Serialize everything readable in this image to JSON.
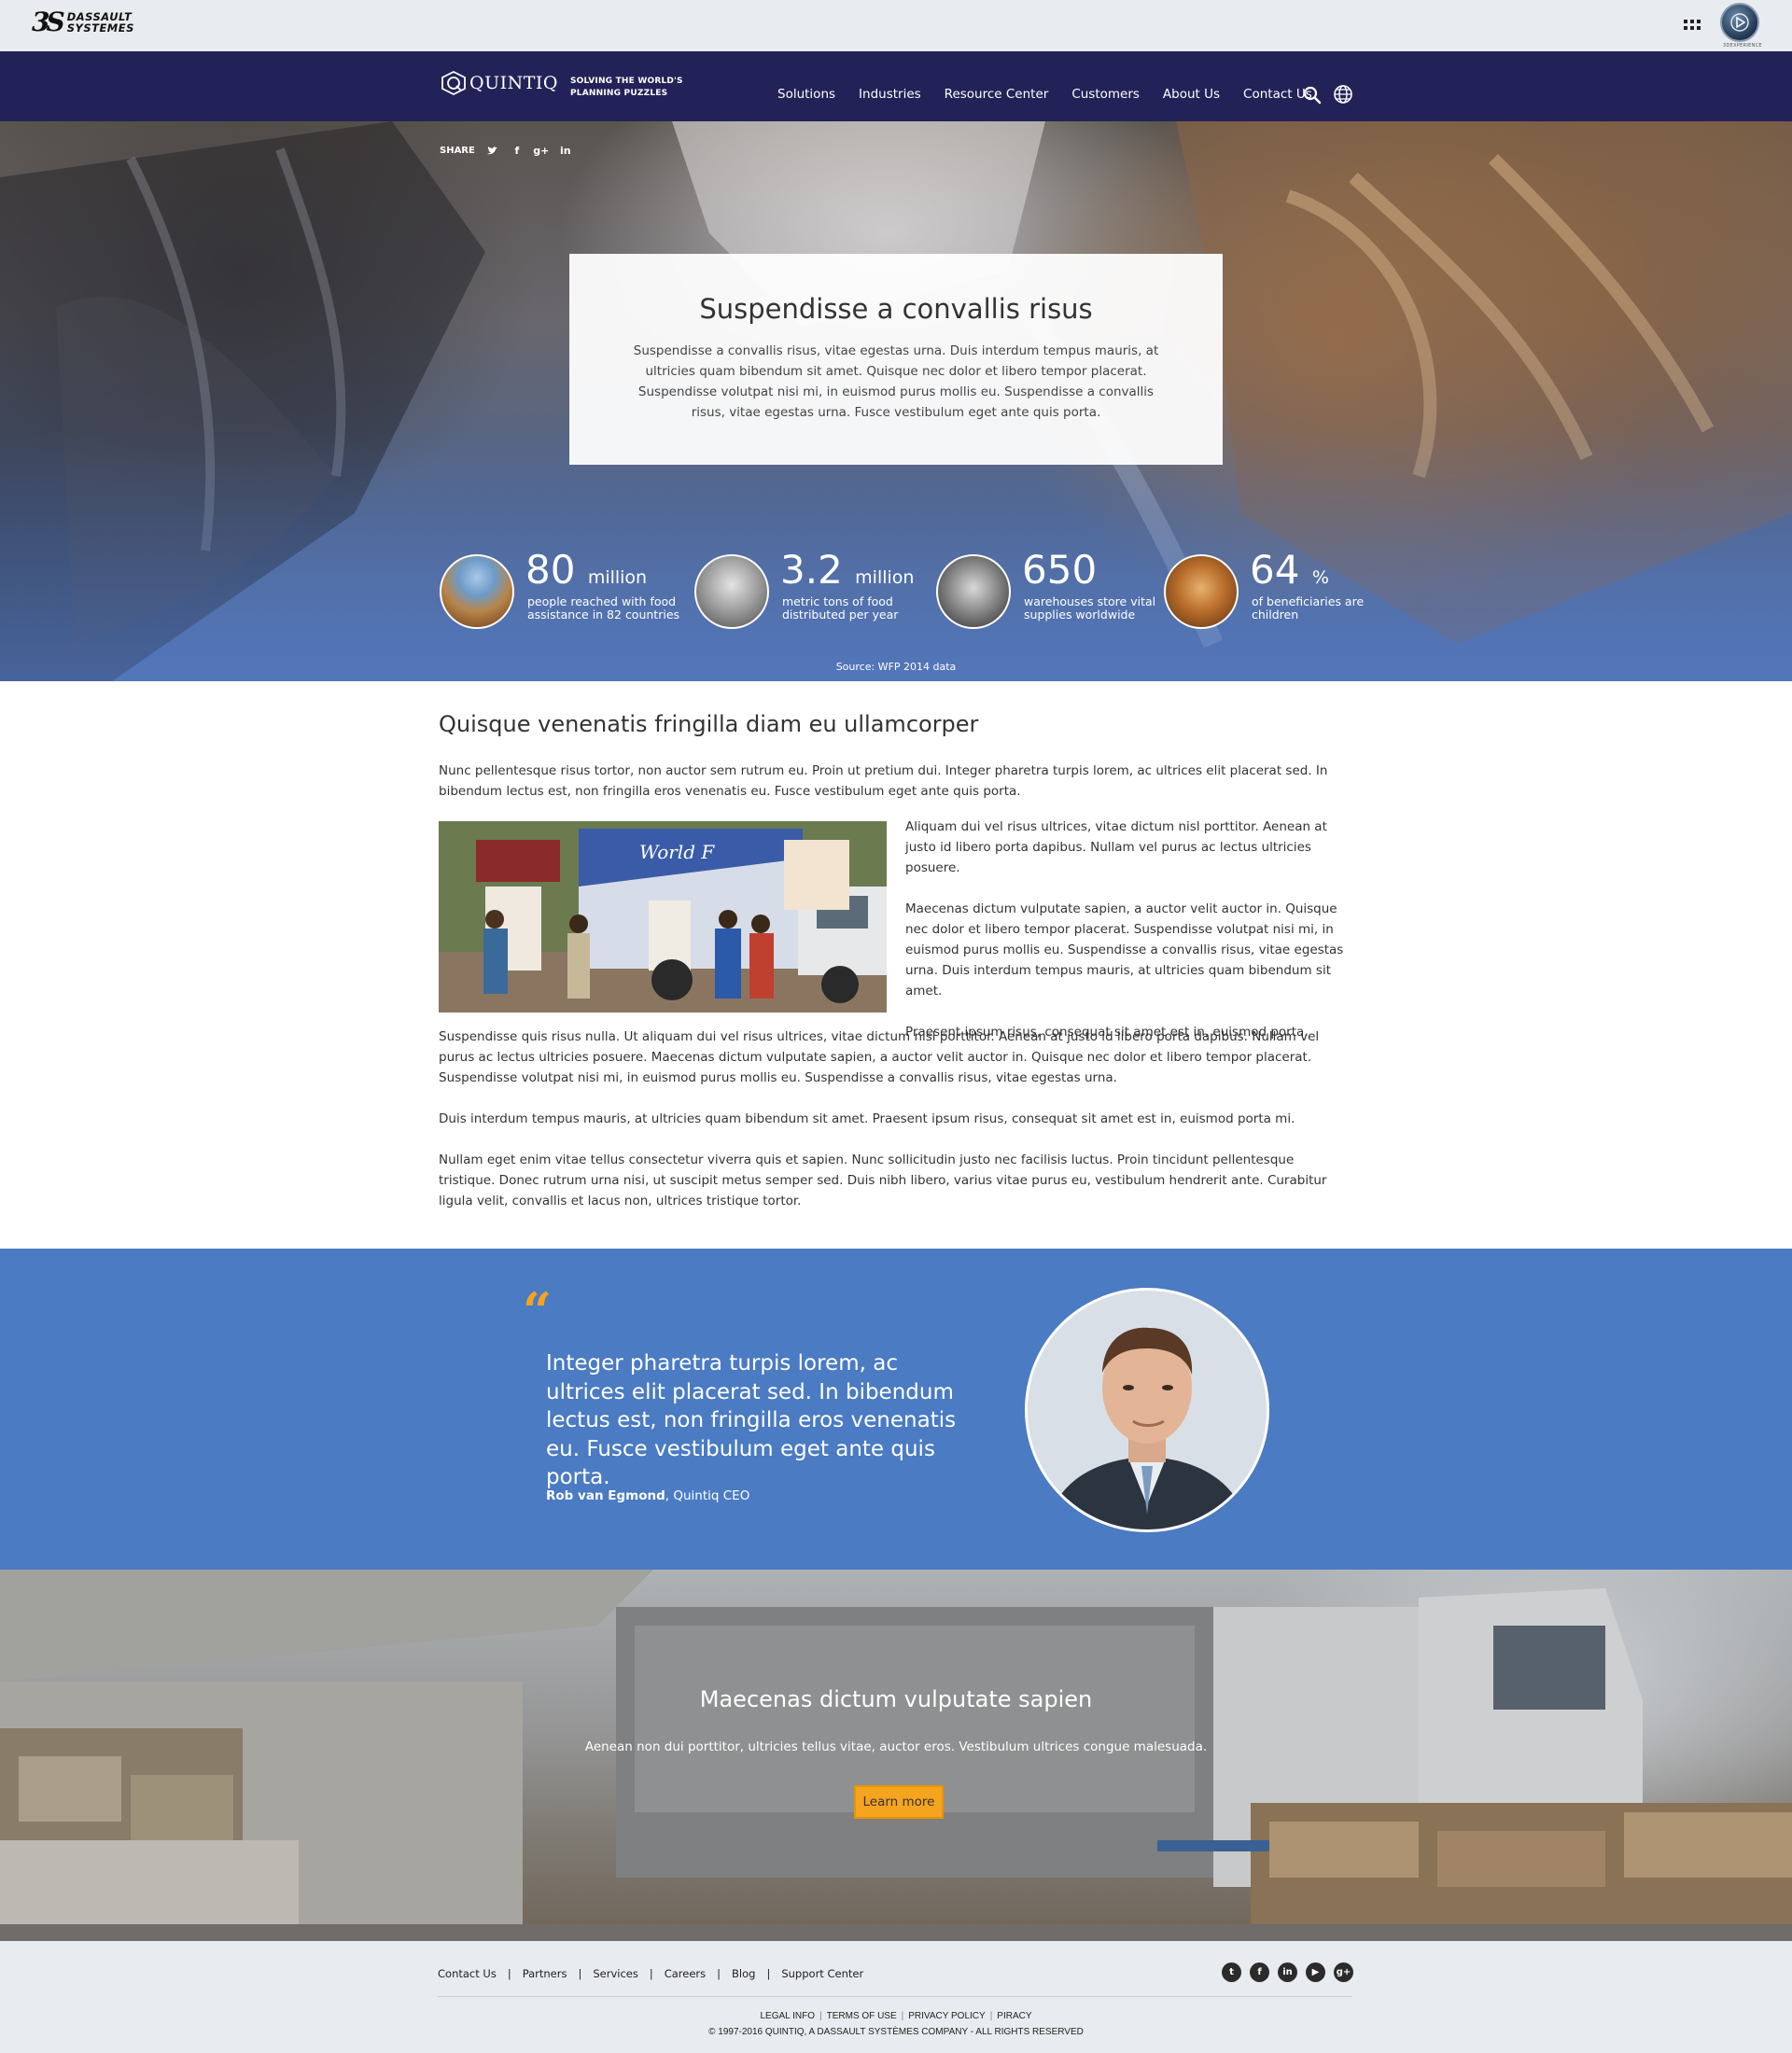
{
  "topbar": {
    "logo_mark": "3S",
    "logo_line1": "DASSAULT",
    "logo_line2": "SYSTEMES",
    "apps_icon": "grid-icon",
    "compass_icon": "compass-icon",
    "compass_label": "3DEXPERIENCE"
  },
  "nav": {
    "brand": "QUINTIQ",
    "tagline_line1": "SOLVING THE WORLD'S",
    "tagline_line2": "PLANNING PUZZLES",
    "items": [
      "Solutions",
      "Industries",
      "Resource Center",
      "Customers",
      "About Us",
      "Contact Us"
    ],
    "icons": [
      "search-icon",
      "globe-icon"
    ]
  },
  "hero": {
    "share_label": "SHARE",
    "share_icons": [
      "twitter-icon",
      "facebook-icon",
      "google-plus-icon",
      "linkedin-icon"
    ],
    "title": "Suspendisse a convallis risus",
    "text": "Suspendisse a convallis risus, vitae egestas urna. Duis interdum tempus mauris, at ultricies quam bibendum sit amet. Quisque nec dolor et libero tempor placerat. Suspendisse volutpat nisi mi, in euismod purus mollis eu. Suspendisse a convallis risus, vitae egestas urna. Fusce vestibulum eget ante quis porta.",
    "stats": [
      {
        "number": "80",
        "unit": "million",
        "desc": "people reached with food assistance in 82 countries"
      },
      {
        "number": "3.2",
        "unit": "million",
        "desc": "metric tons of food distributed per year"
      },
      {
        "number": "650",
        "unit": "",
        "desc": "warehouses store vital supplies worldwide"
      },
      {
        "number": "64",
        "unit": "%",
        "desc": "of beneficiaries are children"
      }
    ],
    "source": "Source: WFP 2014 data"
  },
  "article": {
    "title": "Quisque venenatis fringilla diam eu ullamcorper",
    "intro": "Nunc pellentesque risus tortor, non auctor sem rutrum eu. Proin ut pretium dui. Integer pharetra turpis lorem, ac ultrices elit placerat sed. In bibendum lectus est, non fringilla eros venenatis eu. Fusce vestibulum eget ante quis porta.",
    "side_paragraphs": [
      "Aliquam dui vel risus ultrices, vitae dictum nisl porttitor. Aenean at justo id libero porta dapibus. Nullam vel purus ac lectus ultricies posuere.",
      "Maecenas dictum vulputate sapien, a auctor velit auctor in. Quisque nec dolor et libero tempor placerat. Suspendisse volutpat nisi mi, in euismod purus mollis eu. Suspendisse a convallis risus, vitae egestas urna. Duis interdum tempus mauris, at ultricies quam bibendum sit amet.",
      "Praesent ipsum risus, consequat sit amet est in, euismod porta."
    ],
    "lower_paragraphs": [
      "Suspendisse quis risus nulla. Ut aliquam dui vel risus ultrices, vitae dictum nisl porttitor. Aenean at justo id libero porta dapibus. Nullam vel purus ac lectus ultricies posuere. Maecenas dictum vulputate sapien, a auctor velit auctor in. Quisque nec dolor et libero tempor placerat. Suspendisse volutpat nisi mi, in euismod purus mollis eu. Suspendisse a convallis risus, vitae egestas urna.",
      "Duis interdum tempus mauris, at ultricies quam bibendum sit amet. Praesent ipsum risus, consequat sit amet est in, euismod porta mi.",
      "Nullam eget enim vitae tellus consectetur viverra quis et sapien. Nunc sollicitudin justo nec facilisis luctus. Proin tincidunt pellentesque tristique. Donec rutrum urna nisi, ut suscipit metus semper sed. Duis nibh libero, varius vitae purus eu, vestibulum hendrerit ante. Curabitur ligula velit, convallis et lacus non, ultrices tristique tortor."
    ]
  },
  "quote": {
    "mark": "“",
    "text": "Integer pharetra turpis lorem, ac ultrices elit placerat sed. In bibendum lectus est, non fringilla eros venenatis eu. Fusce vestibulum eget ante quis porta.",
    "author_name": "Rob van Egmond",
    "author_role": ", Quintiq CEO",
    "accent_color": "#f4a321",
    "background_color": "#4a7bc3"
  },
  "banner": {
    "title": "Maecenas dictum vulputate sapien",
    "text": "Aenean non dui porttitor, ultricies tellus vitae, auctor eros. Vestibulum ultrices congue malesuada.",
    "button_label": "Learn more",
    "button_color": "#f5a41f"
  },
  "footer": {
    "links": [
      "Contact Us",
      "Partners",
      "Services",
      "Careers",
      "Blog",
      "Support Center"
    ],
    "separator": "|",
    "social_icons": [
      "twitter-icon",
      "facebook-icon",
      "linkedin-icon",
      "youtube-icon",
      "google-plus-icon"
    ],
    "social_glyphs": [
      "t",
      "f",
      "in",
      "▶",
      "g+"
    ],
    "legal_links": [
      "LEGAL INFO",
      "TERMS OF USE",
      "PRIVACY POLICY",
      "PIRACY"
    ],
    "copyright": "© 1997-2016 QUINTIQ, A DASSAULT SYSTÈMES COMPANY - ALL RIGHTS RESERVED"
  },
  "colors": {
    "nav_bg": "#232258",
    "topbar_bg": "#e8ebef",
    "footer_bg": "#e8ebef"
  }
}
